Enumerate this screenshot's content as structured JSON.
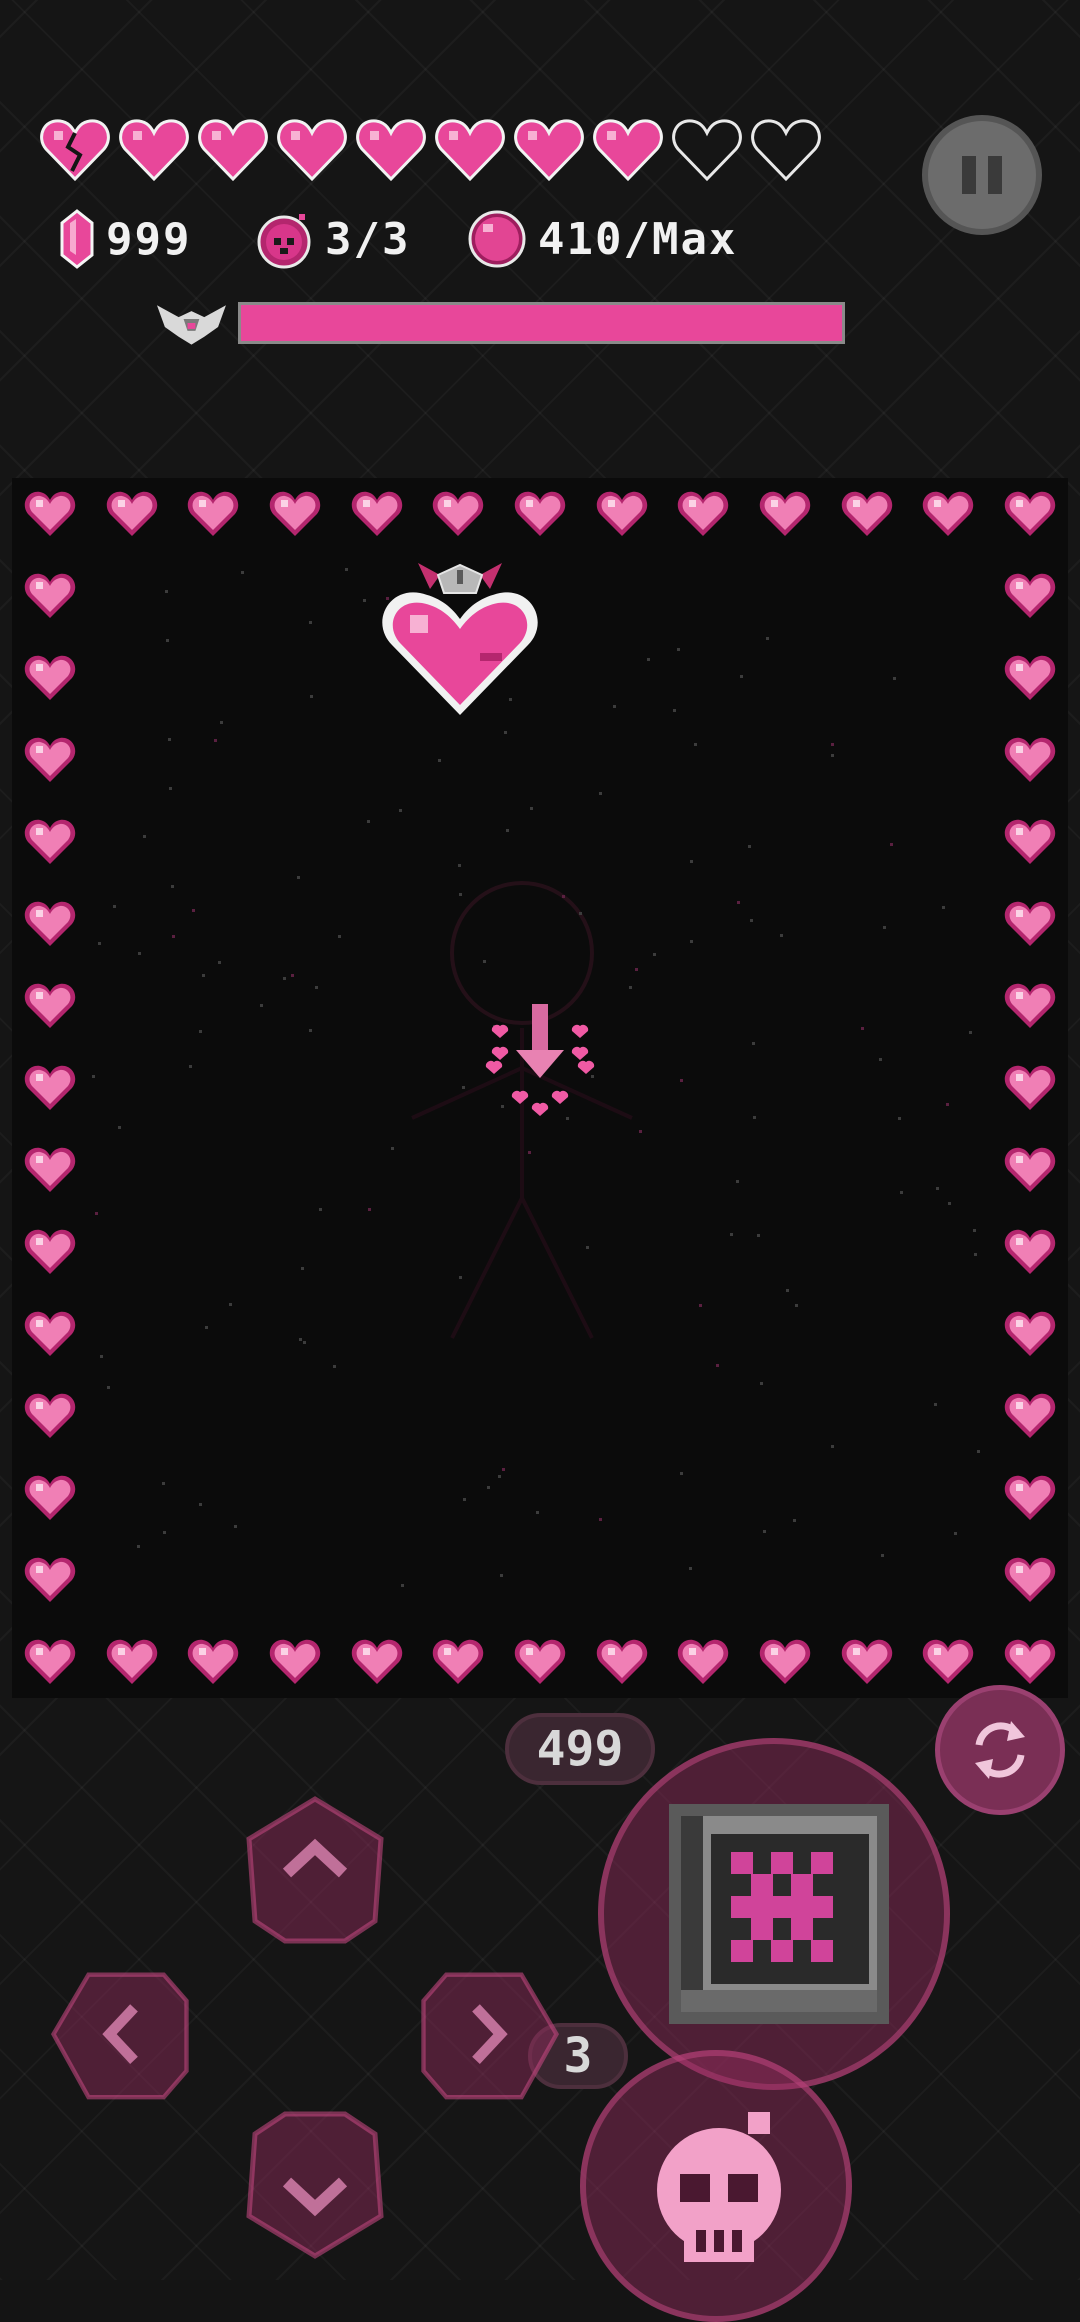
{
  "hud": {
    "hearts": [
      "broken",
      "full",
      "full",
      "full",
      "full",
      "full",
      "full",
      "full",
      "empty",
      "empty"
    ],
    "crystals": "999",
    "bombs": "3/3",
    "orbs": "410/Max",
    "boss_health_fraction": 1.0
  },
  "controls": {
    "weapon_ammo": "499",
    "bomb_count": "3",
    "dpad": [
      "up",
      "left",
      "right",
      "down"
    ]
  },
  "colors": {
    "accent": "#e8479a",
    "heart_light": "#f07fb5",
    "heart_dark": "#b4266e",
    "arena_bg": "#0b0b0b"
  },
  "icons": [
    "crystal-icon",
    "bomb-icon",
    "orb-icon",
    "boss-wing-icon",
    "pause-icon",
    "swap-icon",
    "weapon-chip-icon",
    "skull-bomb-icon"
  ]
}
